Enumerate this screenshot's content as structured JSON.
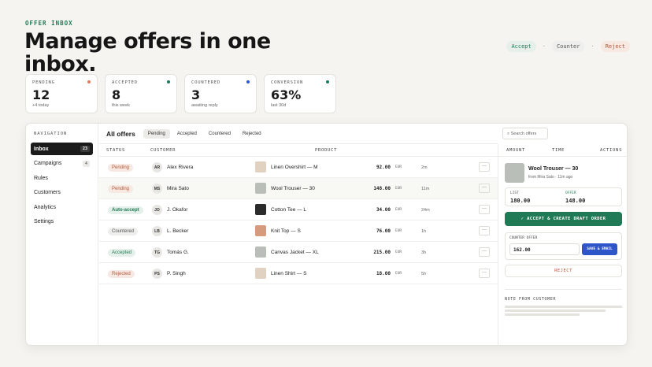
{
  "hero": {
    "eyebrow": "OFFER INBOX",
    "title": "Manage offers in one inbox."
  },
  "legend": {
    "accept": "Accept",
    "counter": "Counter",
    "reject": "Reject",
    "sep": "·"
  },
  "stats": [
    {
      "label": "PENDING",
      "value": "12",
      "sub": "+4 today",
      "dot_color": "#e07a5f"
    },
    {
      "label": "ACCEPTED",
      "value": "8",
      "sub": "this week",
      "dot_color": "#1f7a55"
    },
    {
      "label": "COUNTERED",
      "value": "3",
      "sub": "awaiting reply",
      "dot_color": "#2e56c9"
    },
    {
      "label": "CONVERSION",
      "value": "63%",
      "sub": "last 30d",
      "dot_color": "#1f7a55"
    }
  ],
  "sidebar": {
    "heading": "NAVIGATION",
    "items": [
      {
        "label": "Inbox",
        "count": "23"
      },
      {
        "label": "Campaigns",
        "count": "4"
      },
      {
        "label": "Rules",
        "count": ""
      },
      {
        "label": "Customers",
        "count": ""
      },
      {
        "label": "Analytics",
        "count": ""
      },
      {
        "label": "Settings",
        "count": ""
      }
    ]
  },
  "toolbar": {
    "title": "All offers",
    "tabs": [
      "Pending",
      "Accepted",
      "Countered",
      "Rejected"
    ],
    "search_placeholder": "⌕ Search offers"
  },
  "table": {
    "headers": {
      "status": "STATUS",
      "customer": "CUSTOMER",
      "product": "PRODUCT",
      "amount": "AMOUNT",
      "time": "TIME",
      "actions": "ACTIONS"
    },
    "rows": [
      {
        "status": "Pending",
        "initials": "AR",
        "customer": "Alex Rivera",
        "product": "Linen Overshirt — M",
        "amount": "92.00",
        "currency": "EUR",
        "time": "2m",
        "thumb": "#e0d1c0"
      },
      {
        "status": "Pending",
        "initials": "MS",
        "customer": "Mira Sato",
        "product": "Wool Trouser — 30",
        "amount": "148.00",
        "currency": "EUR",
        "time": "11m",
        "thumb": "#b9bfb8"
      },
      {
        "status": "Auto-accept",
        "initials": "JO",
        "customer": "J. Okafor",
        "product": "Cotton Tee — L",
        "amount": "34.00",
        "currency": "EUR",
        "time": "24m",
        "thumb": "#2b2b2b"
      },
      {
        "status": "Countered",
        "initials": "LB",
        "customer": "L. Becker",
        "product": "Knit Top — S",
        "amount": "76.00",
        "currency": "EUR",
        "time": "1h",
        "thumb": "#d69a7c"
      },
      {
        "status": "Accepted",
        "initials": "TG",
        "customer": "Tomás G.",
        "product": "Canvas Jacket — XL",
        "amount": "215.00",
        "currency": "EUR",
        "time": "3h",
        "thumb": "#b9bfb8"
      },
      {
        "status": "Rejected",
        "initials": "PS",
        "customer": "P. Singh",
        "product": "Linen Shirt — S",
        "amount": "18.00",
        "currency": "EUR",
        "time": "5h",
        "thumb": "#e0d1c0"
      }
    ],
    "more_label": "···"
  },
  "panel": {
    "product_title": "Wool Trouser — 30",
    "product_sub": "from Mira Sato · 11m ago",
    "list_label": "LIST",
    "list_value": "180.00",
    "offer_label": "OFFER",
    "offer_value": "148.00",
    "accept_label": "✓ ACCEPT & CREATE DRAFT ORDER",
    "counter_label": "COUNTER OFFER",
    "counter_value": "162.00",
    "send_label": "SAVE & EMAIL",
    "reject_label": "REJECT",
    "note_label": "NOTE FROM CUSTOMER"
  }
}
